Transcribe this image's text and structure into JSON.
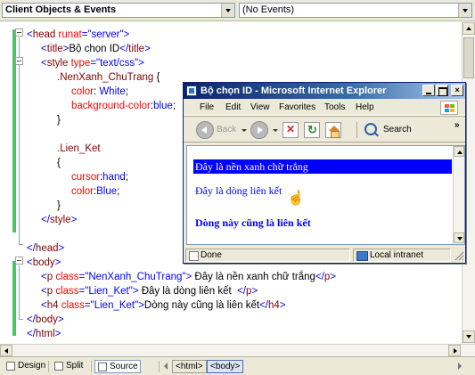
{
  "top": {
    "object_selector": "Client Objects & Events",
    "event_selector": "(No Events)"
  },
  "code_lines": [
    [
      [
        "b",
        "<"
      ],
      [
        "m",
        "head "
      ],
      [
        "r",
        "runat"
      ],
      [
        "b",
        "=\"server\">"
      ]
    ],
    [
      [
        "b",
        "<"
      ],
      [
        "m",
        "title"
      ],
      [
        "b",
        ">"
      ],
      [
        "k",
        "Bộ chọn ID"
      ],
      [
        "b",
        "</"
      ],
      [
        "m",
        "title"
      ],
      [
        "b",
        ">"
      ]
    ],
    [
      [
        "b",
        "<"
      ],
      [
        "m",
        "style "
      ],
      [
        "r",
        "type"
      ],
      [
        "b",
        "=\"text/css\">"
      ]
    ],
    [
      [
        "m",
        ".NenXanh_ChuTrang "
      ],
      [
        "k",
        "{"
      ]
    ],
    [
      [
        "r",
        "color"
      ],
      [
        "k",
        ": "
      ],
      [
        "b",
        "White"
      ],
      [
        "k",
        ";"
      ]
    ],
    [
      [
        "r",
        "background-color"
      ],
      [
        "k",
        ":"
      ],
      [
        "b",
        "blue"
      ],
      [
        "k",
        ";"
      ]
    ],
    [
      [
        "k",
        "}"
      ]
    ],
    [],
    [
      [
        "m",
        ".Lien_Ket"
      ]
    ],
    [
      [
        "k",
        "{"
      ]
    ],
    [
      [
        "r",
        "cursor"
      ],
      [
        "k",
        ":"
      ],
      [
        "b",
        "hand"
      ],
      [
        "k",
        ";"
      ]
    ],
    [
      [
        "r",
        "color"
      ],
      [
        "k",
        ":"
      ],
      [
        "b",
        "Blue"
      ],
      [
        "k",
        ";"
      ]
    ],
    [
      [
        "k",
        "}"
      ]
    ],
    [
      [
        "b",
        "</"
      ],
      [
        "m",
        "style"
      ],
      [
        "b",
        ">"
      ]
    ],
    [],
    [
      [
        "b",
        "</"
      ],
      [
        "m",
        "head"
      ],
      [
        "b",
        ">"
      ]
    ],
    [
      [
        "b",
        "<"
      ],
      [
        "m",
        "body"
      ],
      [
        "b",
        ">"
      ]
    ],
    [
      [
        "b",
        "<"
      ],
      [
        "m",
        "p "
      ],
      [
        "r",
        "class"
      ],
      [
        "b",
        "=\"NenXanh_ChuTrang\">"
      ],
      [
        "k",
        " Đây là nền xanh chữ trắng"
      ],
      [
        "b",
        "</"
      ],
      [
        "m",
        "p"
      ],
      [
        "b",
        ">"
      ]
    ],
    [
      [
        "b",
        "<"
      ],
      [
        "m",
        "p "
      ],
      [
        "r",
        "class"
      ],
      [
        "b",
        "=\"Lien_Ket\">"
      ],
      [
        "k",
        " Đây là dòng liên kết  "
      ],
      [
        "b",
        "</"
      ],
      [
        "m",
        "p"
      ],
      [
        "b",
        ">"
      ]
    ],
    [
      [
        "b",
        "<"
      ],
      [
        "m",
        "h4 "
      ],
      [
        "r",
        "class"
      ],
      [
        "b",
        "=\"Lien_Ket\">"
      ],
      [
        "k",
        "Dòng này cũng là liên kết"
      ],
      [
        "b",
        "</"
      ],
      [
        "m",
        "h4"
      ],
      [
        "b",
        ">"
      ]
    ],
    [
      [
        "b",
        "</"
      ],
      [
        "m",
        "body"
      ],
      [
        "b",
        ">"
      ]
    ],
    [
      [
        "b",
        "</"
      ],
      [
        "m",
        "html"
      ],
      [
        "b",
        ">"
      ]
    ]
  ],
  "bottom": {
    "design_tab": "Design",
    "split_tab": "Split",
    "source_tab": "Source",
    "crumb_html": "<html>",
    "crumb_body": "<body>"
  },
  "ie": {
    "title": "Bộ chọn ID - Microsoft Internet Explorer",
    "menu": [
      "File",
      "Edit",
      "View",
      "Favorites",
      "Tools",
      "Help"
    ],
    "back_label": "Back",
    "search_label": "Search",
    "chevron": "»",
    "close_glyph": "×",
    "hand_glyph": "☝",
    "content": {
      "blue_bar": "Đây là nền xanh chữ trắng",
      "link_line": "Đây là dòng liên kết",
      "heading": "Dòng này cũng là liên kết"
    },
    "status_done": "Done",
    "status_zone": "Local intranet"
  }
}
